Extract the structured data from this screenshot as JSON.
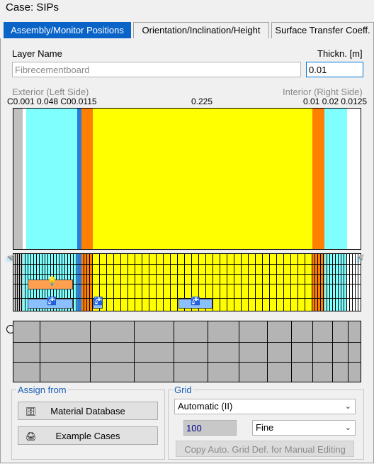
{
  "case_title": "Case:  SIPs",
  "tabs": [
    {
      "label": "Assembly/Monitor Positions"
    },
    {
      "label": "Orientation/Inclination/Height"
    },
    {
      "label": "Surface Transfer Coeff."
    }
  ],
  "layer_name_label": "Layer Name",
  "layer_name_value": "Fibrecementboard",
  "thickness_label": "Thickn. [m]",
  "thickness_value": "0.01",
  "exterior_label": "Exterior (Left Side)",
  "interior_label": "Interior (Right Side)",
  "thickness_scale": {
    "left": "C0.001  0.048  C00.0115",
    "center": "0.225",
    "right": "0.01 0.02 0.0125"
  },
  "assign_from": {
    "legend": "Assign from",
    "material_db": "Material Database",
    "example_cases": "Example Cases"
  },
  "grid": {
    "legend": "Grid",
    "mode": "Automatic (II)",
    "count": "100",
    "resolution": "Fine",
    "copy_button": "Copy Auto. Grid Def. for Manual Editing"
  },
  "colors": {
    "cyan": "#80ffff",
    "blue": "#2a7bdc",
    "orange": "#ff7f00",
    "yellow": "#ffff00",
    "tab_active": "#0a64c8"
  }
}
